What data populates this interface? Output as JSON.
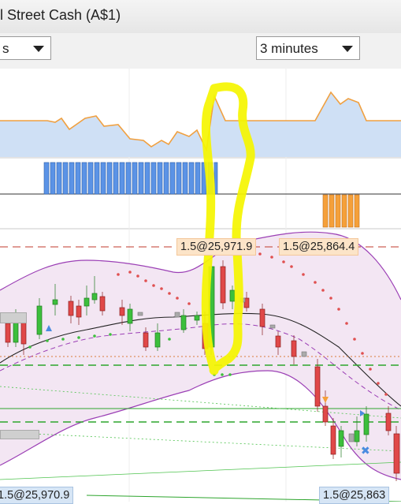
{
  "window": {
    "title": "l Street Cash (A$1)"
  },
  "toolbar": {
    "left_select_value": "s",
    "interval_select_value": "3 minutes"
  },
  "price_tags": {
    "tag1": "1.5@25,971.9",
    "tag2": "1.5@25,864.4",
    "bottom_left": "1.5@25,970.9",
    "bottom_right": "1.5@25,863"
  },
  "colors": {
    "bull_candle": "#3cbf3c",
    "bear_candle": "#e04848",
    "volume_blue": "#5b93e6",
    "volume_orange": "#f5a03a",
    "bollinger": "#9b3fb5",
    "highlight": "#f5f500"
  }
}
